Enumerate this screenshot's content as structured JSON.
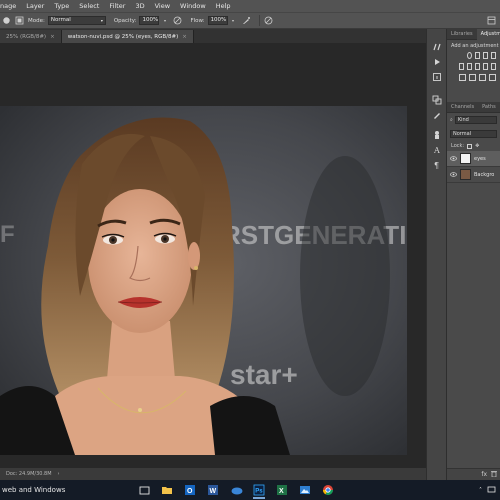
{
  "menu": {
    "items": [
      "nage",
      "Layer",
      "Type",
      "Select",
      "Filter",
      "3D",
      "View",
      "Window",
      "Help"
    ]
  },
  "options": {
    "mode_label": "Mode:",
    "mode_value": "Normal",
    "opacity_label": "Opacity:",
    "opacity_value": "100%",
    "flow_label": "Flow:",
    "flow_value": "100%"
  },
  "doc_tabs": [
    {
      "label": "25% (RGB/8#)",
      "active": false
    },
    {
      "label": "watson-nuvi.psd @ 25% (eyes, RGB/8#)",
      "active": true
    }
  ],
  "status": {
    "doc_info": "Doc: 24.9M/30.8M"
  },
  "panels": {
    "top_tabs": [
      "Libraries",
      "Adjustme"
    ],
    "add_adjustment": "Add an adjustment",
    "layer_tabs": [
      "Channels",
      "Paths"
    ],
    "kind_value": "Kind",
    "blend_value": "Normal",
    "lock_label": "Lock:",
    "layers": [
      {
        "name": "eyes",
        "selected": true
      },
      {
        "name": "Backgro",
        "selected": false
      }
    ],
    "bottom_icons": [
      "fx",
      "trash-icon"
    ]
  },
  "taskbar": {
    "search_text": "web and Windows",
    "apps": [
      "task-view-icon",
      "file-explorer-icon",
      "outlook-icon",
      "word-icon",
      "onedrive-icon",
      "photoshop-icon",
      "excel-icon",
      "photos-icon",
      "chrome-icon"
    ]
  },
  "colors": {
    "chrome_bg": "#535353",
    "canvas_bg": "#282828",
    "accent": "#31a8ff",
    "taskbar": "#141b26"
  }
}
